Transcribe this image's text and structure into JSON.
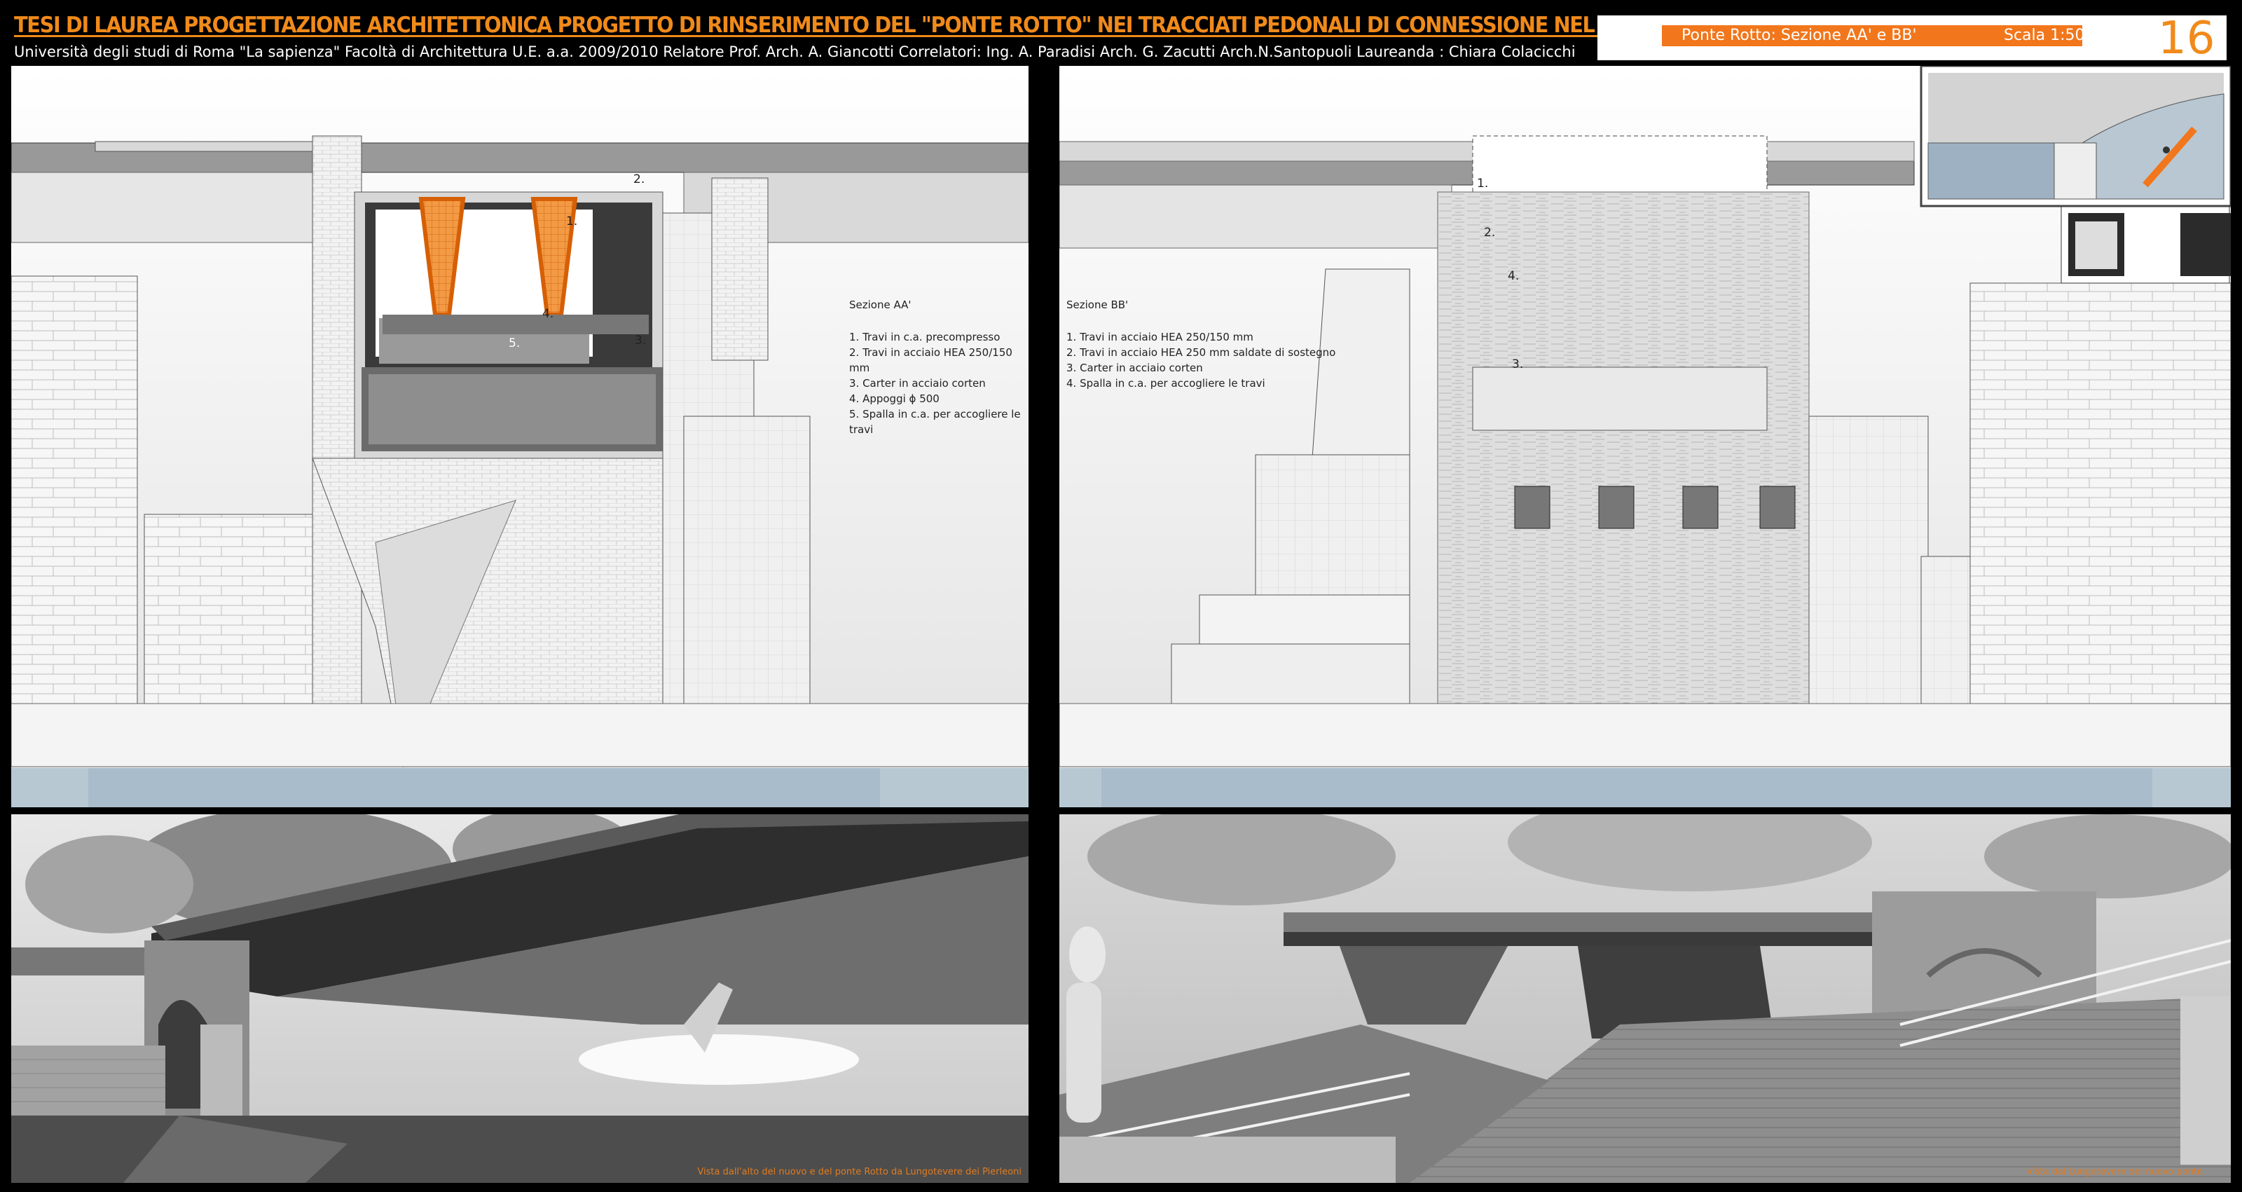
{
  "header": {
    "title": "TESI DI LAUREA    PROGETTAZIONE ARCHITETTONICA    PROGETTO DI RINSERIMENTO DEL  \"PONTE ROTTO\" NEI TRACCIATI PEDONALI  DI CONNESSIONE NEL TESSUTO URBANO DI ROMA",
    "subtitle": "Università degli studi di Roma \"La sapienza\" Facoltà di Architettura U.E. a.a. 2009/2010   Relatore Prof. Arch. A. Giancotti   Correlatori:   Ing. A. Paradisi   Arch. G. Zacutti   Arch.N.Santopuoli    Laureanda : Chiara Colacicchi",
    "plate_label": "Ponte Rotto:  Sezione  AA' e BB'",
    "plate_scale": "Scala 1:50",
    "plate_number": "16"
  },
  "section_aa": {
    "title": "Sezione  AA'",
    "items": [
      "1. Travi in c.a. precompresso",
      "2. Travi in acciaio HEA 250/150 mm",
      "3. Carter in acciaio corten",
      "4. Appoggi ϕ 500",
      "5. Spalla in c.a. per accogliere le travi"
    ],
    "markers": [
      "1.",
      "2.",
      "3.",
      "4.",
      "5."
    ]
  },
  "section_bb": {
    "title": "Sezione  BB'",
    "items": [
      "1. Travi in acciaio HEA 250/150 mm",
      "2. Travi in acciaio HEA 250 mm saldate di sostegno",
      "3. Carter in acciaio corten",
      "4. Spalla in c.a. per accogliere le travi"
    ],
    "markers": [
      "1.",
      "2.",
      "3.",
      "4."
    ]
  },
  "renders": {
    "left_caption": "Vista dall'alto del nuovo e del ponte Rotto da Lungotevere dei Pierleoni",
    "right_caption": "Vista dal  Lungotevere del nuovo  ponte"
  },
  "colors": {
    "accent": "#f2761b",
    "water": "#b7c8d3",
    "background": "#000000"
  }
}
